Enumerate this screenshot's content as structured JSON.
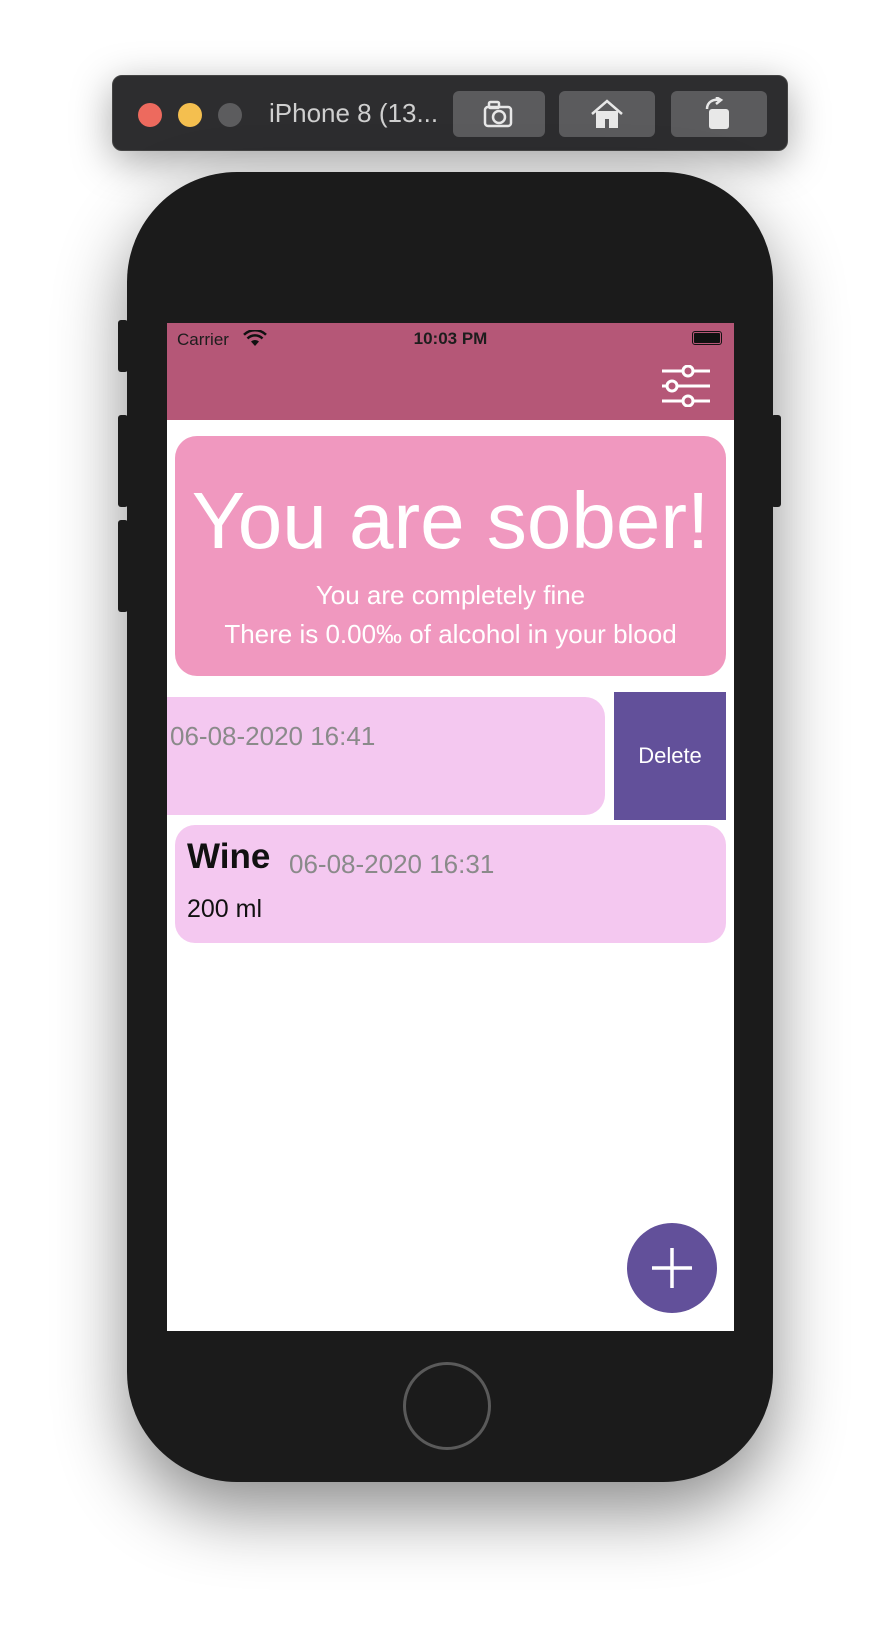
{
  "simulator": {
    "title": "iPhone 8 (13...",
    "buttons": [
      {
        "name": "screenshot-button",
        "icon": "camera-icon"
      },
      {
        "name": "home-button",
        "icon": "home-icon"
      },
      {
        "name": "rotate-button",
        "icon": "rotate-icon"
      }
    ]
  },
  "status_bar": {
    "carrier": "Carrier",
    "time": "10:03 PM"
  },
  "nav": {
    "filter_icon": "sliders-icon"
  },
  "status_card": {
    "title": "You are sober!",
    "subtitle": "You are completely fine",
    "detail": "There is 0.00‰ of alcohol in your blood"
  },
  "entries": [
    {
      "name": "",
      "datetime": "06-08-2020 16:41",
      "amount": "",
      "action": "Delete"
    },
    {
      "name": "Wine",
      "datetime": "06-08-2020 16:31",
      "amount": "200 ml"
    }
  ],
  "fab": {
    "icon": "plus-icon"
  },
  "colors": {
    "nav": "#b55777",
    "card": "#f098bf",
    "entry": "#f4c8f0",
    "accent": "#62509a"
  }
}
